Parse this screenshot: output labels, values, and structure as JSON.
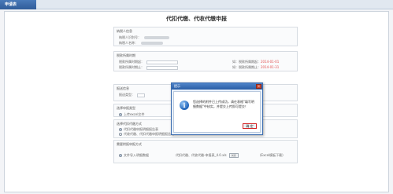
{
  "tab": {
    "label": "申请表"
  },
  "page": {
    "title": "代扣代缴、代收代缴申报"
  },
  "taxpayer": {
    "title": "纳税人信息",
    "id_label": "纳税人识别号：",
    "name_label": "纳税人名称："
  },
  "period": {
    "title": "税款所属时期",
    "start_label": "税款所属时期起：",
    "end_label": "税款所属时期止：",
    "start_hint_label": "如：税款所属期起：",
    "start_hint_value": "2014-01-01",
    "end_hint_label": "如：税款所属期止：",
    "end_hint_value": "2014-01-31"
  },
  "report": {
    "title": "报送信息",
    "type_label": "报送类型："
  },
  "select_type": {
    "title": "选择申报类型",
    "option1": "上传excel文件"
  },
  "select_method": {
    "title": "选择代扣代缴方式",
    "option1": "代扣代缴申报明细报告表",
    "option2": "代收代缴、代扣代缴申报明细报告表"
  },
  "file_method": {
    "title": "需要附报申报方式",
    "option1": "文件导入明细数据",
    "file_name": "代扣代缴、代收代缴-申报表_4.0.xls",
    "browse_label": "浏览",
    "hint": "(Excel模板下载)"
  },
  "dialog": {
    "title": "提示",
    "close_glyph": "×",
    "icon_glyph": "i",
    "message": "您选择的附件已上传成功，请在表格\"填写明细数据\"中核实，并提交上传即可提交！",
    "ok_label": "确 定"
  }
}
